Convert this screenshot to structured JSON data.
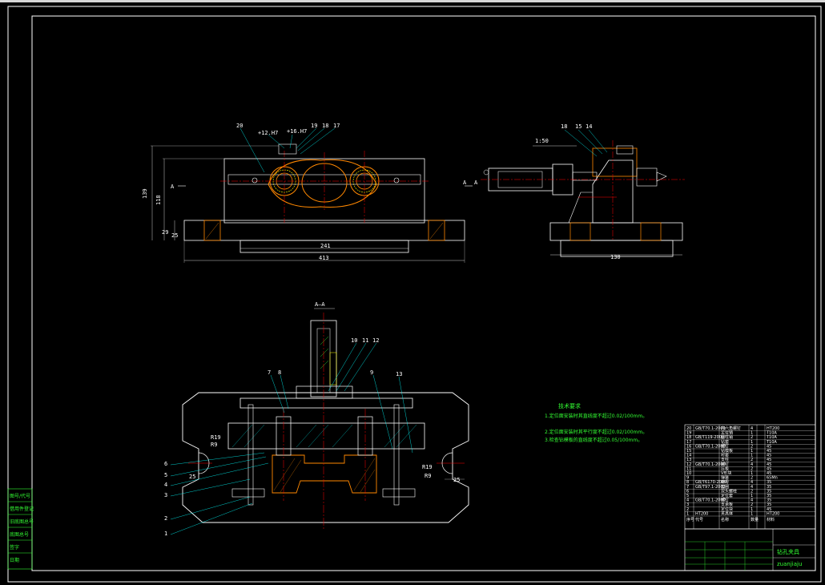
{
  "section_label": "A—A",
  "view_marks": {
    "left": "A",
    "right": "A",
    "side_left": "A",
    "side_right": "A"
  },
  "dimensions": {
    "front_total_width": "413",
    "front_base_width": "241",
    "front_height": "139",
    "front_height_inner": "118",
    "front_base_h1": "29",
    "front_base_h2": "25",
    "side_width": "130",
    "scale_note": "1:50",
    "bottom_radius_l": "R19",
    "bottom_radius_l2": "R9",
    "bottom_dim_l": "25",
    "bottom_radius_r": "R19",
    "bottom_radius_r2": "R9",
    "bottom_dim_r": "25"
  },
  "front_balloons": [
    "20",
    "+12.H7",
    "+16.H7",
    "19",
    "18",
    "17"
  ],
  "side_balloons": [
    "18",
    "15",
    "14"
  ],
  "section_balloons_top": [
    "7",
    "8",
    "10",
    "11",
    "12",
    "9",
    "13"
  ],
  "section_balloons_left": [
    "6",
    "5",
    "4",
    "3",
    "2",
    "1"
  ],
  "tech_requirements": {
    "title": "技术要求",
    "items": [
      "1.定位面安装时其直线度不超过0.02/100mm。",
      "2.定位面安装时其平行度不超过0.02/100mm。",
      "3.检查钻模板的直线度不超过0.05/100mm。"
    ]
  },
  "title_block": {
    "name_cn": "钻孔夹具",
    "name_pinyin": "zuanjiaju",
    "rows": [
      [
        "20",
        "GB/T70.1-2000",
        "内六角螺钉",
        "4",
        "",
        "HT200"
      ],
      [
        "19",
        "",
        "定位销",
        "1",
        "",
        "T10A"
      ],
      [
        "18",
        "GB/T119-2000",
        "圆柱销",
        "2",
        "",
        "T10A"
      ],
      [
        "17",
        "",
        "钻套",
        "1",
        "",
        "T10A"
      ],
      [
        "16",
        "GB/T70.1-2000",
        "螺钉",
        "2",
        "",
        "45"
      ],
      [
        "15",
        "",
        "钻模板",
        "1",
        "",
        "45"
      ],
      [
        "14",
        "",
        "衬套",
        "1",
        "",
        "45"
      ],
      [
        "13",
        "",
        "支柱",
        "2",
        "",
        "45"
      ],
      [
        "12",
        "GB/T70.1-2000",
        "螺钉",
        "4",
        "",
        "45"
      ],
      [
        "11",
        "",
        "压板",
        "2",
        "",
        "45"
      ],
      [
        "10",
        "",
        "V形块",
        "1",
        "",
        "45"
      ],
      [
        "9",
        "",
        "弹簧",
        "2",
        "",
        "65Mn"
      ],
      [
        "8",
        "GB/T6170-2000",
        "螺母",
        "4",
        "",
        "35"
      ],
      [
        "7",
        "GB/T97.1-2002",
        "垫圈",
        "4",
        "",
        "35"
      ],
      [
        "6",
        "",
        "双头螺柱",
        "2",
        "",
        "35"
      ],
      [
        "5",
        "",
        "定位套",
        "1",
        "",
        "35"
      ],
      [
        "4",
        "GB/T70.1-2000",
        "螺钉",
        "4",
        "",
        "35"
      ],
      [
        "3",
        "",
        "支承板",
        "2",
        "",
        "35"
      ],
      [
        "2",
        "",
        "定位块",
        "1",
        "",
        "45"
      ],
      [
        "1",
        "HT200",
        "夹具体",
        "1",
        "",
        "HT200"
      ]
    ],
    "header": [
      "序号",
      "代号",
      "名称",
      "数量",
      "",
      "材料"
    ]
  },
  "left_tabs": [
    "图号/代号",
    "借用件登记",
    "旧底图总号",
    "底图总号",
    "签字",
    "日期"
  ],
  "colors": {
    "line": "#ffffff",
    "red": "#ff0000",
    "orange": "#ff8800",
    "yellow": "#ffff00",
    "green": "#33ff33",
    "cyan": "#00ffff"
  }
}
